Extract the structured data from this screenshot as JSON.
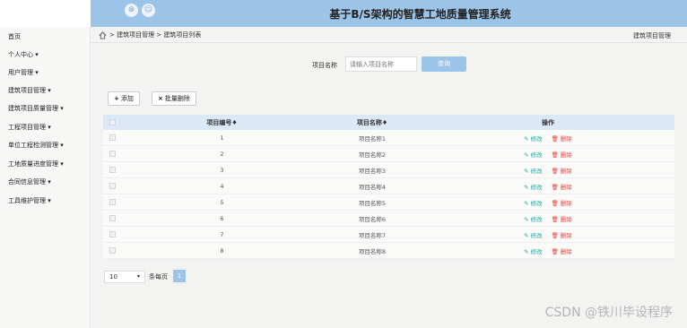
{
  "header": {
    "title": "基于B/S架构的智慧工地质量管理系统",
    "icons": [
      "close-circle-icon",
      "user-icon"
    ],
    "icon_glyphs": [
      "⊗",
      "☺"
    ]
  },
  "sidebar": {
    "items": [
      {
        "label": "首页"
      },
      {
        "label": "个人中心 ▾"
      },
      {
        "label": "用户管理 ▾"
      },
      {
        "label": "建筑项目管理 ▾"
      },
      {
        "label": "建筑项目质量管理 ▾"
      },
      {
        "label": "工程项目管理 ▾"
      },
      {
        "label": "单位工程检测管理 ▾"
      },
      {
        "label": "工地质量进度管理 ▾"
      },
      {
        "label": "合同信息管理 ▾"
      },
      {
        "label": "工具维护管理 ▾"
      }
    ]
  },
  "breadcrumb": {
    "text": "> 建筑项目管理 > 建筑项目列表",
    "right": "建筑项目管理"
  },
  "search": {
    "label": "项目名称",
    "placeholder": "请输入项目名称",
    "button": "查询"
  },
  "toolbar": {
    "add_icon": "+",
    "add_label": "添加",
    "batch_icon": "×",
    "batch_label": "批量删除"
  },
  "table": {
    "headers": {
      "no": "项目编号♦",
      "name": "项目名称♦",
      "ops": "操作"
    },
    "edit_label": "✎ 修改",
    "delete_label": "🗑 删除",
    "rows": [
      {
        "no": "1",
        "name": "项目名称1"
      },
      {
        "no": "2",
        "name": "项目名称2"
      },
      {
        "no": "3",
        "name": "项目名称3"
      },
      {
        "no": "4",
        "name": "项目名称4"
      },
      {
        "no": "5",
        "name": "项目名称5"
      },
      {
        "no": "6",
        "name": "项目名称6"
      },
      {
        "no": "7",
        "name": "项目名称7"
      },
      {
        "no": "8",
        "name": "项目名称8"
      }
    ]
  },
  "pager": {
    "size": "10",
    "size_arrow": "▾",
    "per_page": "条每页",
    "current": "1"
  },
  "watermark": "CSDN @铁川毕设程序",
  "colors": {
    "accent": "#9cc3e8",
    "edit": "#1ba5a0",
    "delete": "#e0443f"
  }
}
